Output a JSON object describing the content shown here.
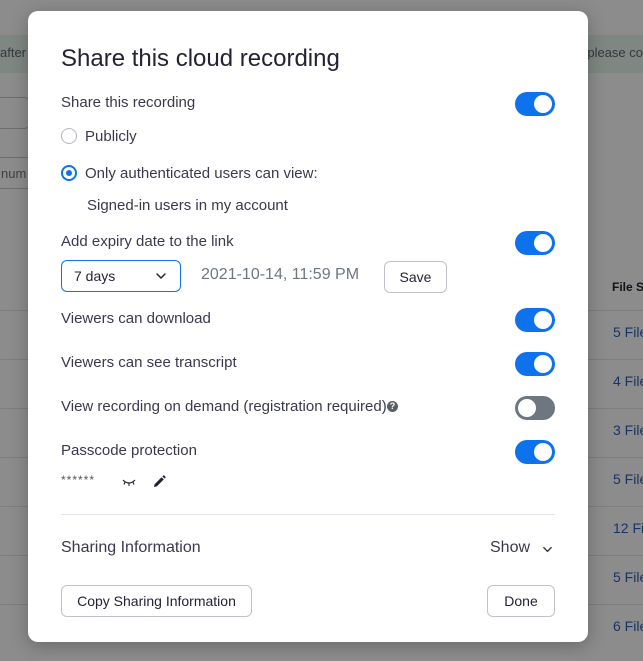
{
  "background": {
    "banner_left_text": "after t",
    "banner_right_text": "please co",
    "input_text": "num",
    "column_header": "File Si",
    "rows": [
      "5 File",
      "4 File",
      "3 File",
      "5 File",
      "12 Fi",
      "5 File",
      "6 File"
    ]
  },
  "dialog": {
    "title": "Share this cloud recording",
    "share_recording": {
      "label": "Share this recording",
      "enabled": true
    },
    "visibility": {
      "options": [
        {
          "label": "Publicly",
          "selected": false
        },
        {
          "label": "Only authenticated users can view:",
          "selected": true
        }
      ],
      "authenticated_detail": "Signed-in users in my account"
    },
    "expiry": {
      "label": "Add expiry date to the link",
      "enabled": true,
      "duration_selected": "7 days",
      "date_text": "2021-10-14, 11:59 PM",
      "save_label": "Save"
    },
    "viewers_download": {
      "label": "Viewers can download",
      "enabled": true
    },
    "viewers_transcript": {
      "label": "Viewers can see transcript",
      "enabled": true
    },
    "on_demand": {
      "label": "View recording on demand (registration required)",
      "info_icon": "?",
      "enabled": false
    },
    "passcode": {
      "label": "Passcode protection",
      "enabled": true,
      "masked_value": "******"
    },
    "sharing_info": {
      "label": "Sharing Information",
      "toggle_label": "Show"
    },
    "copy_button_label": "Copy Sharing Information",
    "done_button_label": "Done"
  },
  "colors": {
    "accent": "#0e72ed",
    "toggle_off": "#6e7680",
    "link": "#2d5fb8"
  },
  "icons": [
    "info-icon",
    "eye-closed-icon",
    "pencil-icon",
    "chevron-down-icon"
  ]
}
